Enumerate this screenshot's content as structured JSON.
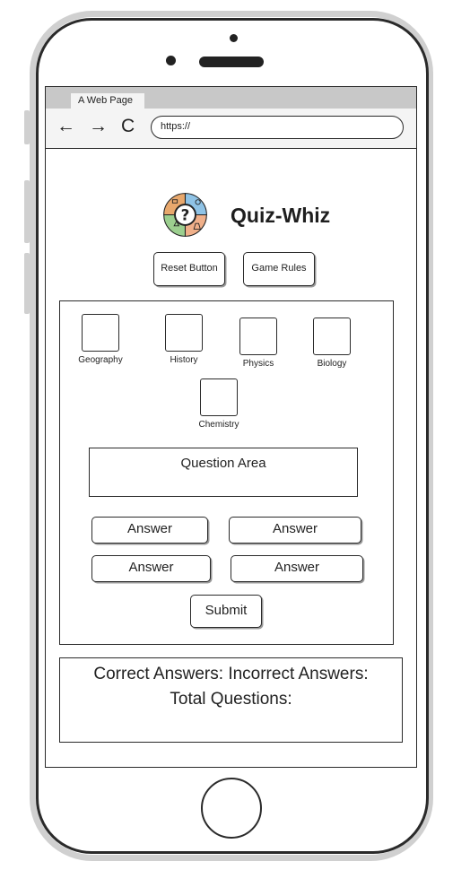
{
  "browser": {
    "tab_title": "A Web Page",
    "url": "https://",
    "nav": {
      "back": "←",
      "forward": "→",
      "reload": "C"
    }
  },
  "header": {
    "title": "Quiz-Whiz",
    "logo_icon": "quiz-logo-icon",
    "logo_colors": [
      "#e8a86d",
      "#8fc3e6",
      "#9ccf8f",
      "#f0b08a"
    ]
  },
  "controls": {
    "reset_label": "Reset Button",
    "rules_label": "Game Rules"
  },
  "categories": [
    {
      "label": "Geography"
    },
    {
      "label": "History"
    },
    {
      "label": "Physics"
    },
    {
      "label": "Biology"
    },
    {
      "label": "Chemistry"
    }
  ],
  "quiz": {
    "question_label": "Question Area",
    "answers": [
      "Answer",
      "Answer",
      "Answer",
      "Answer"
    ],
    "submit_label": "Submit"
  },
  "score": {
    "line1": "Correct Answers: Incorrect Answers:",
    "line2": "Total Questions:"
  }
}
